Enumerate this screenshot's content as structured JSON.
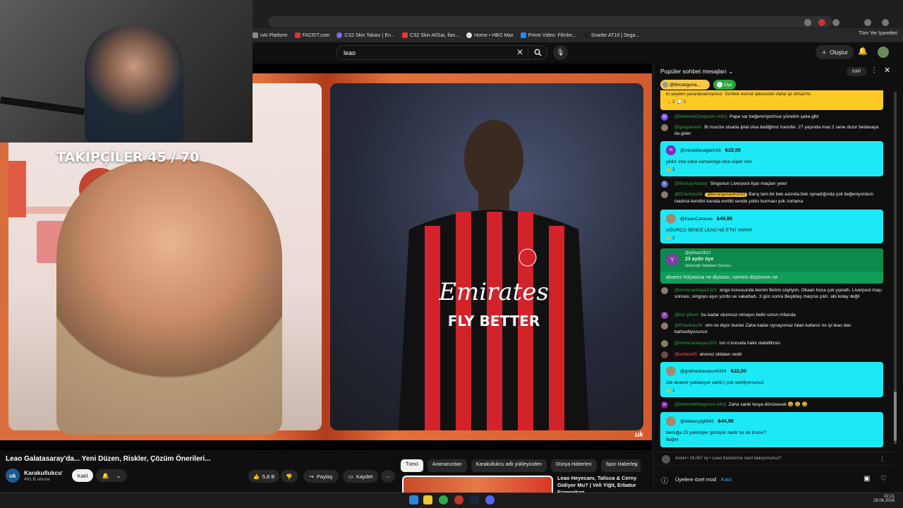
{
  "bookmarks": {
    "items": [
      "nAI Platform",
      "FACEIT.com",
      "CS2 Skin Takası | En...",
      "CS2 Skin Al/Sat, İlan...",
      "Home • HBO Max",
      "Prime Video: Filmler...",
      "Snarler AT10 | Sega..."
    ],
    "right": "Tüm Yer İşaretleri"
  },
  "header": {
    "search_value": "leao",
    "create_label": "Oluştur"
  },
  "video": {
    "overlay_text": "TAKİPÇİLER 45 / 70",
    "logo": "uk",
    "jersey_sponsor": "Emirates",
    "jersey_sponsor2": "FLY BETTER",
    "title": "Leao Galatasaray'da... Yeni Düzen, Riskler, Çözüm Önerileri...",
    "channel": {
      "name": "Karakullukcu",
      "subs": "491 B abone",
      "avatar_text": "uk"
    },
    "join_label": "Katıl",
    "likes": "5,8 B",
    "share_label": "Paylaş",
    "save_label": "Kaydet"
  },
  "chips": [
    "Tümü",
    "Aramanızdan",
    "Karakullukcu adlı yükleyiciden",
    "Dünya Haberleri",
    "Spor Haberleri"
  ],
  "recommended": {
    "title": "Leao Heyecanı, Talisca & Cerny Gidiyor Mu? | Veli Yiğit, Erbatur Ergenekon,"
  },
  "chat": {
    "title": "Popüler sohbet mesajları",
    "oxp": "0XP",
    "chip_user": "@bircanguna...",
    "chip_member": "Üye",
    "top_yellow": {
      "text": "bi şeyden yararlanamıyoruz. Sorbek evinse jakoustan daha iyi olmazmı.",
      "likes": "2",
      "replies": "1"
    },
    "messages_a": [
      {
        "user": "@MehmetGokgoren-rk6zj",
        "text": "Pape sar beğenmiyormus yönetim şaka gibi",
        "av": "M"
      },
      {
        "user": "@gaspartech",
        "text": "Bi mucize olsada iptal olsa dediğimiz transfer. 27 yaşında max 2 sene durur bedavaya da gider",
        "av": ""
      }
    ],
    "sc1": {
      "user": "@mustafasaglam16",
      "amount": "₺22,00",
      "text": "yıldız orta saha camavinga olsa süper olur",
      "likes": "2",
      "av": "m"
    },
    "messages_b": [
      {
        "user": "@BerkayAtabey",
        "text": "Singonun Liverpool Ajax maçları yeter",
        "av": "B"
      },
      {
        "user": "@Ertanbas34",
        "mention": "@bircangunaydn2039",
        "text": "Barış tam bir bek aslında bek oynadığında çok beğeniyordum inadına kendini kanata evriltti sende yıldız kurması yok zorlama",
        "av": ""
      }
    ],
    "sc2": {
      "user": "@KaanCaracas",
      "amount": "₺44,99",
      "text": "UĞURÇO SENCE LEAO NE ETKİ YAPAR",
      "likes": "2"
    },
    "member": {
      "user": "@yilmaz2612",
      "months": "23 aydır üye",
      "level": "Geleceği Vadeden Oyuncu",
      "text": "alvarez hülyasına ne diyosun, samimi düşüncen ne",
      "av": "Y"
    },
    "messages_c": [
      {
        "user": "@emrecankaya1320",
        "text": "singo konusunda benim fikrimi söyliyim. Okaan hoca çok yıprattı. Liverpool maçı sonrası, singoyu aşırı yordu ve sakatladı. 3 gün sonra Beşiktaş maçına çıktı. abi kolay değil",
        "av": ""
      },
      {
        "user": "@ton-jj8wm",
        "text": "bu kadar olumsuz olmayın belki sorun milanda",
        "av": "F"
      },
      {
        "user": "@Ertanbas34",
        "text": "olm ne diyor bunlar Zaha kadar oynaysmaz falan kafanız mı iyi leao dan bahsediyosunuz",
        "av": ""
      },
      {
        "user": "@emrecankaya1320",
        "text": "ton o konuda haklı olabilillirsin",
        "av": ""
      },
      {
        "user": "@esfara43",
        "text": "alverez iddaları nedir",
        "av": ""
      }
    ],
    "sc3": {
      "user": "@gokhankarakurt4204",
      "amount": "₺22,00",
      "text": "Abi alvarez yaklaşıyor sanki:) çok seviliyorsunuz",
      "likes": "1"
    },
    "message_d": {
      "user": "@Mehmet6okgoren-rk6zj",
      "text": "Zaha sanki leoya dönüsecek 😃 😃 😃",
      "av": "M"
    },
    "sc4": {
      "user": "@elekocyigit942",
      "amount": "₺44,99",
      "text": "bertuğa 15 çekmişler görüşün nedir bir de bruno?",
      "link": "İlteğim"
    },
    "poll": "Anket • 28.067 oy • Leao transferine nasıl bakıyorsunuz?",
    "member_mode": "Üyelere özel mod",
    "member_join": "Katıl"
  },
  "clock": {
    "time": "02:21",
    "date": "29.08.2026"
  }
}
